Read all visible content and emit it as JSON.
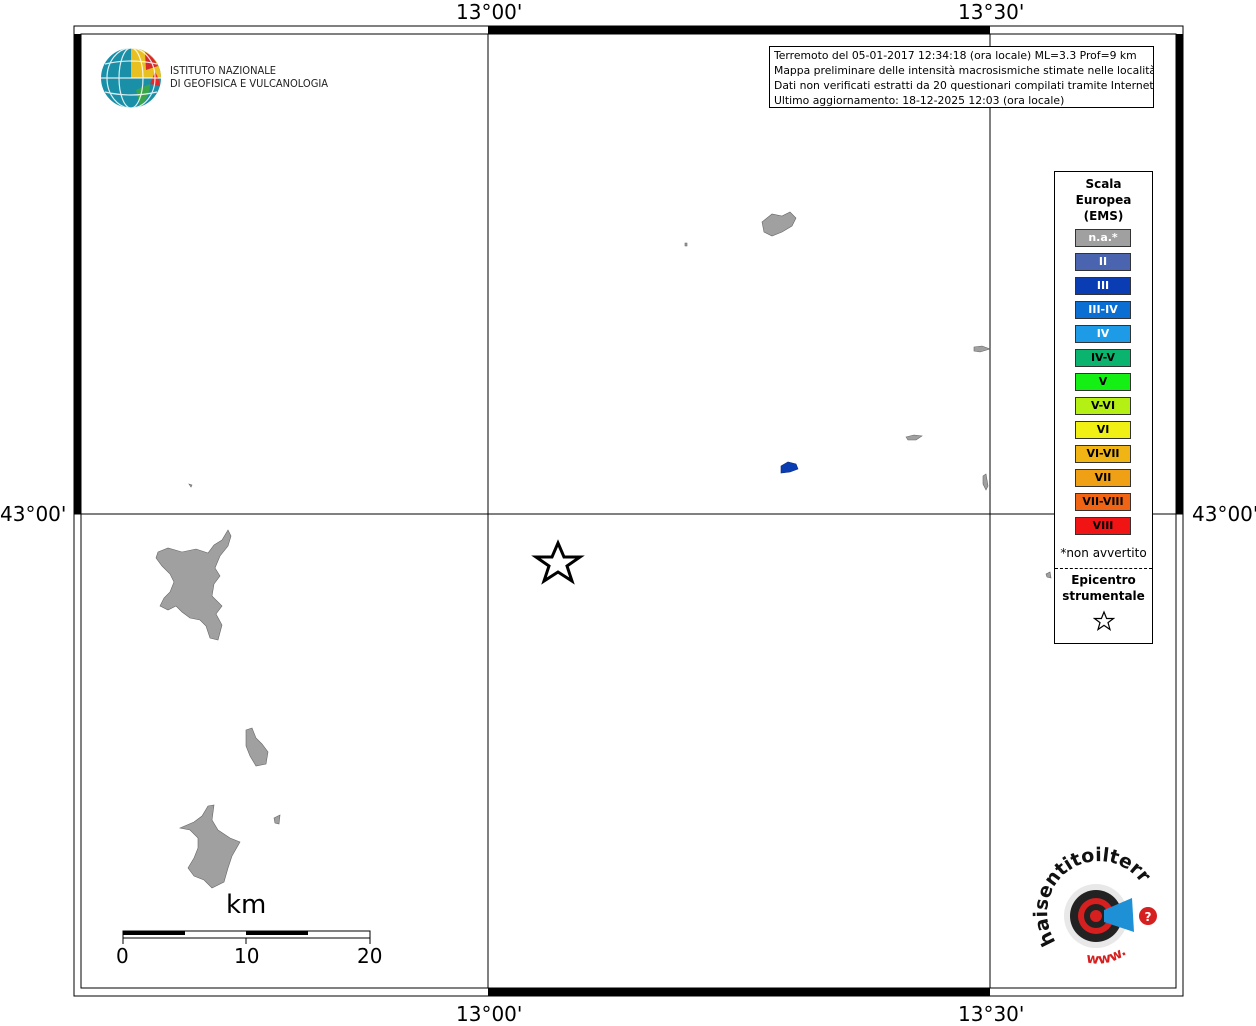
{
  "map": {
    "coordinates": {
      "top_left_lon": "13°00'",
      "top_right_lon": "13°30'",
      "bottom_left_lon": "13°00'",
      "bottom_right_lon": "13°30'",
      "left_lat": "43°00'",
      "right_lat": "43°00'"
    },
    "region_fill": "#a0a0a0",
    "intensity_marker_color": "#0a3cb4"
  },
  "logo": {
    "line1": "ISTITUTO NAZIONALE",
    "line2": "DI GEOFISICA E VULCANOLOGIA"
  },
  "info": {
    "line1": "Terremoto del 05-01-2017 12:34:18 (ora locale) ML=3.3 Prof=9 km",
    "line2": "Mappa preliminare delle intensità macrosismiche stimate nelle località",
    "line3": "Dati non verificati estratti da 20 questionari compilati tramite Internet.",
    "line4": "Ultimo aggiornamento: 18-12-2025 12:03 (ora locale)"
  },
  "legend": {
    "title_line1": "Scala",
    "title_line2": "Europea",
    "title_line3": "(EMS)",
    "items": [
      {
        "label": "n.a.*",
        "color": "#a0a0a0",
        "text_color": "#ffffff"
      },
      {
        "label": "II",
        "color": "#4a64b0",
        "text_color": "#ffffff"
      },
      {
        "label": "III",
        "color": "#0a3cb4",
        "text_color": "#ffffff"
      },
      {
        "label": "III-IV",
        "color": "#0a6ed2",
        "text_color": "#ffffff"
      },
      {
        "label": "IV",
        "color": "#1e9be6",
        "text_color": "#ffffff"
      },
      {
        "label": "IV-V",
        "color": "#0ab46e",
        "text_color": "#000000"
      },
      {
        "label": "V",
        "color": "#14f014",
        "text_color": "#000000"
      },
      {
        "label": "V-VI",
        "color": "#b4f014",
        "text_color": "#000000"
      },
      {
        "label": "VI",
        "color": "#f0f014",
        "text_color": "#000000"
      },
      {
        "label": "VI-VII",
        "color": "#f0b414",
        "text_color": "#000000"
      },
      {
        "label": "VII",
        "color": "#f0a014",
        "text_color": "#000000"
      },
      {
        "label": "VII-VIII",
        "color": "#f06414",
        "text_color": "#000000"
      },
      {
        "label": "VIII",
        "color": "#f01414",
        "text_color": "#000000"
      }
    ],
    "note": "*non avvertito",
    "epicenter_line1": "Epicentro",
    "epicenter_line2": "strumentale"
  },
  "scale_bar": {
    "unit": "km",
    "ticks": [
      "0",
      "10",
      "20"
    ]
  },
  "brand": {
    "text_top": "haisentitoilterremoto.it",
    "text_bottom": "www."
  }
}
